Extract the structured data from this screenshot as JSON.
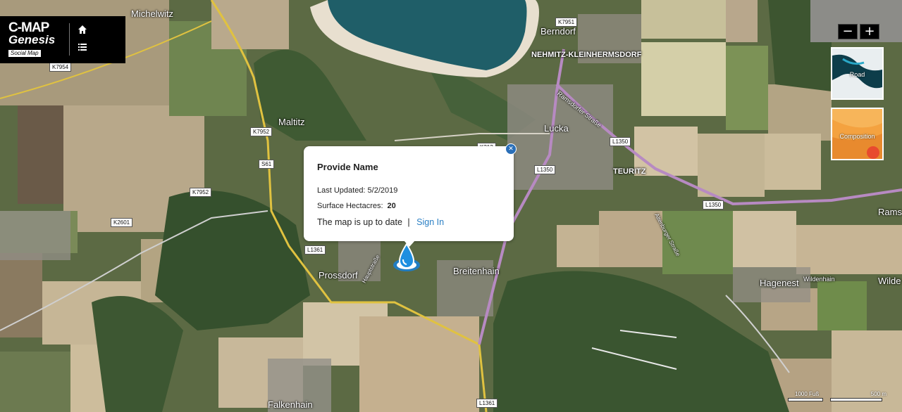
{
  "brand": {
    "line1": "C-MAP",
    "line2": "Genesis",
    "line3": "Social Map"
  },
  "icons": {
    "home": "home-icon",
    "menu": "list-menu-icon",
    "marker": "water-drop-marker-icon",
    "close": "close-icon"
  },
  "zoom": {
    "out_label": "−",
    "in_label": "+"
  },
  "layers": [
    {
      "label": "Road"
    },
    {
      "label": "Composition"
    }
  ],
  "popup": {
    "title": "Provide Name",
    "updated_label": "Last Updated: 5/2/2019",
    "hectares_label": "Surface Hectacres:",
    "hectares_value": "20",
    "status_text": "The map is up to date",
    "separator": "|",
    "signin_label": "Sign In"
  },
  "places": {
    "michelwitz": "Michelwitz",
    "berndorf": "Berndorf",
    "nehmitz": "NEHMITZ-KLEINHERMSDORF",
    "maltitz": "Maltitz",
    "lucka": "Lucka",
    "teuritz": "TEURITZ",
    "prossdorf": "Prossdorf",
    "breitenhain": "Breitenhain",
    "hagenest": "Hagenest",
    "wildenhain": "Wildenhain",
    "rams": "Rams",
    "wilde": "Wilde",
    "falkenhain": "Falkenhain",
    "ramsdorfer": "Ramsdorfer Straße",
    "altenburger": "Altenburger Straße",
    "hauptstrasse": "Hauptstraße"
  },
  "roads": {
    "k7951": "K7951",
    "k7954": "K7954",
    "k7952a": "K7952",
    "s61": "S61",
    "k7952b": "K7952",
    "k2601": "K2601",
    "l1361a": "L1361",
    "l1350a": "L1350",
    "l1350b": "L1350",
    "l1350c": "L1350",
    "l1361b": "L1361",
    "k313": "K313"
  },
  "scale": {
    "feet": "1000 Fuß",
    "meters": "500 m"
  },
  "colors": {
    "accent": "#2a7fc4",
    "water": "#1f5e68",
    "brand_bg": "#000000"
  }
}
